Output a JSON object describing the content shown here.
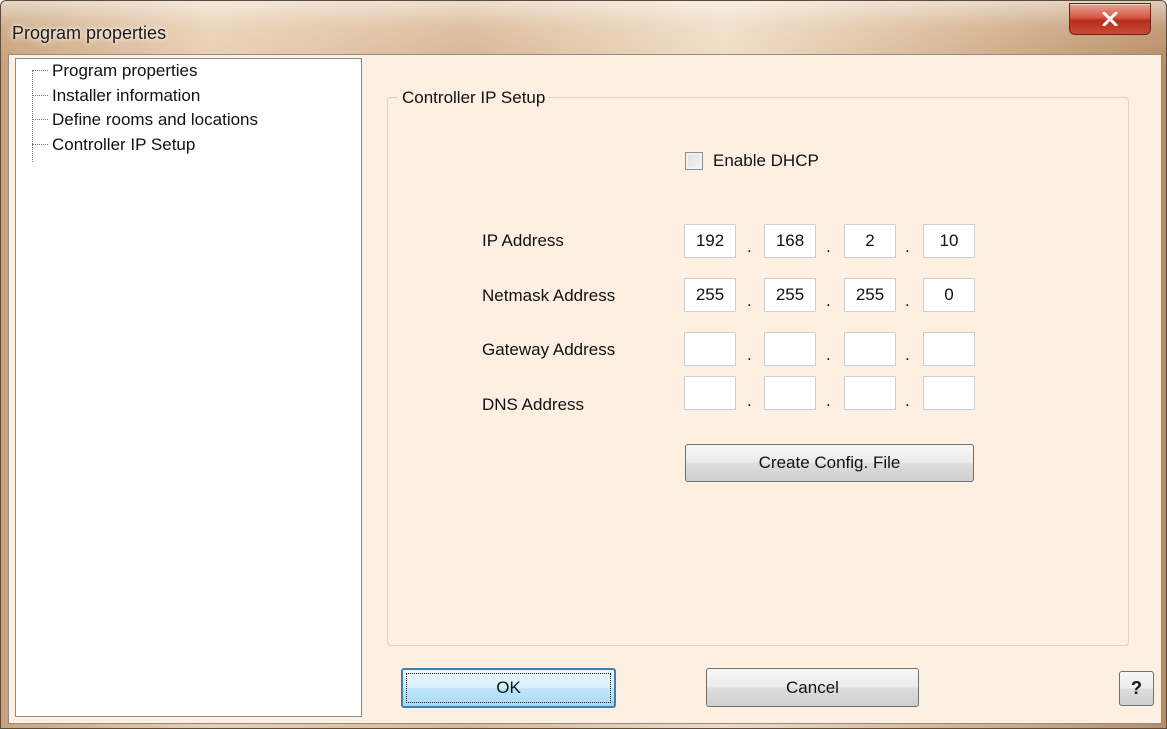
{
  "window": {
    "title": "Program properties",
    "close_label": "X"
  },
  "tree": {
    "items": [
      {
        "label": "Program properties"
      },
      {
        "label": "Installer information"
      },
      {
        "label": "Define rooms and locations"
      },
      {
        "label": "Controller IP Setup"
      }
    ]
  },
  "panel": {
    "group_title": "Controller IP Setup",
    "dhcp": {
      "label": "Enable DHCP",
      "checked": false
    },
    "fields": [
      {
        "label": "IP Address",
        "octets": [
          "192",
          "168",
          "2",
          "10"
        ]
      },
      {
        "label": "Netmask Address",
        "octets": [
          "255",
          "255",
          "255",
          "0"
        ]
      },
      {
        "label": "Gateway Address",
        "octets": [
          "",
          "",
          "",
          ""
        ]
      },
      {
        "label": "DNS Address",
        "octets": [
          "",
          "",
          "",
          ""
        ]
      }
    ],
    "separator": ".",
    "create_button": "Create Config. File"
  },
  "footer": {
    "ok_label": "OK",
    "cancel_label": "Cancel",
    "help_label": "?"
  },
  "colors": {
    "panel_bg": "#fdf0e2",
    "close_red": "#c84a33",
    "default_button_border": "#3c7fb1"
  }
}
